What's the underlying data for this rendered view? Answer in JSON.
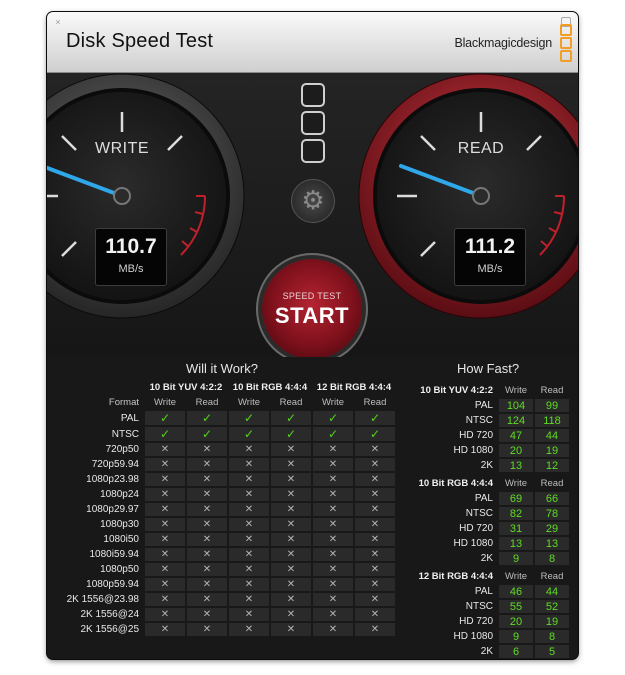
{
  "window": {
    "title": "Disk Speed Test",
    "brand": "Blackmagicdesign",
    "close_glyph": "×"
  },
  "gauges": {
    "write": {
      "label": "WRITE",
      "value": "110.7",
      "unit": "MB/s"
    },
    "read": {
      "label": "READ",
      "value": "111.2",
      "unit": "MB/s"
    }
  },
  "start_button": {
    "small": "SPEED TEST",
    "big": "START"
  },
  "will_it_work": {
    "title": "Will it Work?",
    "format_label": "Format",
    "groups": [
      {
        "name": "10 Bit YUV 4:2:2",
        "cols": [
          "Write",
          "Read"
        ]
      },
      {
        "name": "10 Bit RGB 4:4:4",
        "cols": [
          "Write",
          "Read"
        ]
      },
      {
        "name": "12 Bit RGB 4:4:4",
        "cols": [
          "Write",
          "Read"
        ]
      }
    ],
    "rows": [
      {
        "format": "PAL",
        "ok": [
          true,
          true,
          true,
          true,
          true,
          true
        ]
      },
      {
        "format": "NTSC",
        "ok": [
          true,
          true,
          true,
          true,
          true,
          true
        ]
      },
      {
        "format": "720p50",
        "ok": [
          false,
          false,
          false,
          false,
          false,
          false
        ]
      },
      {
        "format": "720p59.94",
        "ok": [
          false,
          false,
          false,
          false,
          false,
          false
        ]
      },
      {
        "format": "1080p23.98",
        "ok": [
          false,
          false,
          false,
          false,
          false,
          false
        ]
      },
      {
        "format": "1080p24",
        "ok": [
          false,
          false,
          false,
          false,
          false,
          false
        ]
      },
      {
        "format": "1080p29.97",
        "ok": [
          false,
          false,
          false,
          false,
          false,
          false
        ]
      },
      {
        "format": "1080p30",
        "ok": [
          false,
          false,
          false,
          false,
          false,
          false
        ]
      },
      {
        "format": "1080i50",
        "ok": [
          false,
          false,
          false,
          false,
          false,
          false
        ]
      },
      {
        "format": "1080i59.94",
        "ok": [
          false,
          false,
          false,
          false,
          false,
          false
        ]
      },
      {
        "format": "1080p50",
        "ok": [
          false,
          false,
          false,
          false,
          false,
          false
        ]
      },
      {
        "format": "1080p59.94",
        "ok": [
          false,
          false,
          false,
          false,
          false,
          false
        ]
      },
      {
        "format": "2K 1556@23.98",
        "ok": [
          false,
          false,
          false,
          false,
          false,
          false
        ]
      },
      {
        "format": "2K 1556@24",
        "ok": [
          false,
          false,
          false,
          false,
          false,
          false
        ]
      },
      {
        "format": "2K 1556@25",
        "ok": [
          false,
          false,
          false,
          false,
          false,
          false
        ]
      }
    ]
  },
  "how_fast": {
    "title": "How Fast?",
    "groups": [
      {
        "name": "10 Bit YUV 4:2:2",
        "write_label": "Write",
        "read_label": "Read",
        "rows": [
          {
            "format": "PAL",
            "write": "104",
            "read": "99"
          },
          {
            "format": "NTSC",
            "write": "124",
            "read": "118"
          },
          {
            "format": "HD 720",
            "write": "47",
            "read": "44"
          },
          {
            "format": "HD 1080",
            "write": "20",
            "read": "19"
          },
          {
            "format": "2K",
            "write": "13",
            "read": "12"
          }
        ]
      },
      {
        "name": "10 Bit RGB 4:4:4",
        "write_label": "Write",
        "read_label": "Read",
        "rows": [
          {
            "format": "PAL",
            "write": "69",
            "read": "66"
          },
          {
            "format": "NTSC",
            "write": "82",
            "read": "78"
          },
          {
            "format": "HD 720",
            "write": "31",
            "read": "29"
          },
          {
            "format": "HD 1080",
            "write": "13",
            "read": "13"
          },
          {
            "format": "2K",
            "write": "9",
            "read": "8"
          }
        ]
      },
      {
        "name": "12 Bit RGB 4:4:4",
        "write_label": "Write",
        "read_label": "Read",
        "rows": [
          {
            "format": "PAL",
            "write": "46",
            "read": "44"
          },
          {
            "format": "NTSC",
            "write": "55",
            "read": "52"
          },
          {
            "format": "HD 720",
            "write": "20",
            "read": "19"
          },
          {
            "format": "HD 1080",
            "write": "9",
            "read": "8"
          },
          {
            "format": "2K",
            "write": "6",
            "read": "5"
          }
        ]
      }
    ]
  },
  "colors": {
    "needle": "#2fa8ea",
    "read_ring": "#b3202a",
    "ok_green": "#5ad31f",
    "value_green": "#5fdc23",
    "brand_orange": "#f29d23"
  },
  "icons": {
    "settings": "gear-icon",
    "check": "checkmark-icon",
    "cross": "cross-icon",
    "target_slot": "rounded-square-icon"
  }
}
